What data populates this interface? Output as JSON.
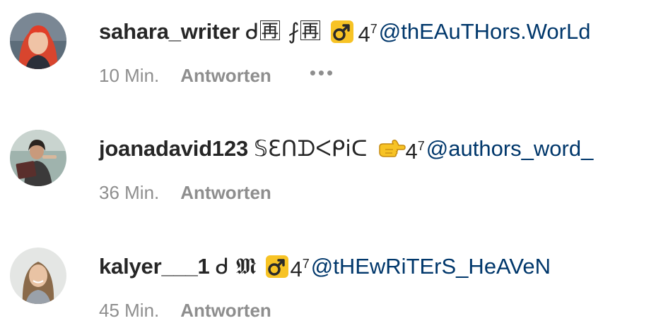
{
  "comments": [
    {
      "username": "sahara_writer",
      "decoration": "ᑯ🈞 ⨏🈞",
      "emoji_icon": "male-sign-emoji-icon",
      "badge": "4",
      "badge_sup": "7",
      "mention": "@thEAuTHors.WorLd",
      "time": "10 Min.",
      "reply_label": "Antworten",
      "more_label": "•••"
    },
    {
      "username": "joanadavid123",
      "decoration": "𝕊Ɛᑎᗪᐸᑭiᑕ",
      "emoji_icon": "pointing-right-emoji-icon",
      "badge": "4",
      "badge_sup": "7",
      "mention": "@authors_word_",
      "time": "36 Min.",
      "reply_label": "Antworten"
    },
    {
      "username": "kalyer___1",
      "decoration": "ᑯ 𝕸",
      "emoji_icon": "male-sign-emoji-icon",
      "badge": "4",
      "badge_sup": "7",
      "mention": "@tHEwRiTErS_HeAVeN",
      "time": "45 Min.",
      "reply_label": "Antworten"
    }
  ],
  "colors": {
    "text": "#262626",
    "muted": "#8e8e8e",
    "mention": "#00376b",
    "emoji_yellow": "#f7c325"
  }
}
